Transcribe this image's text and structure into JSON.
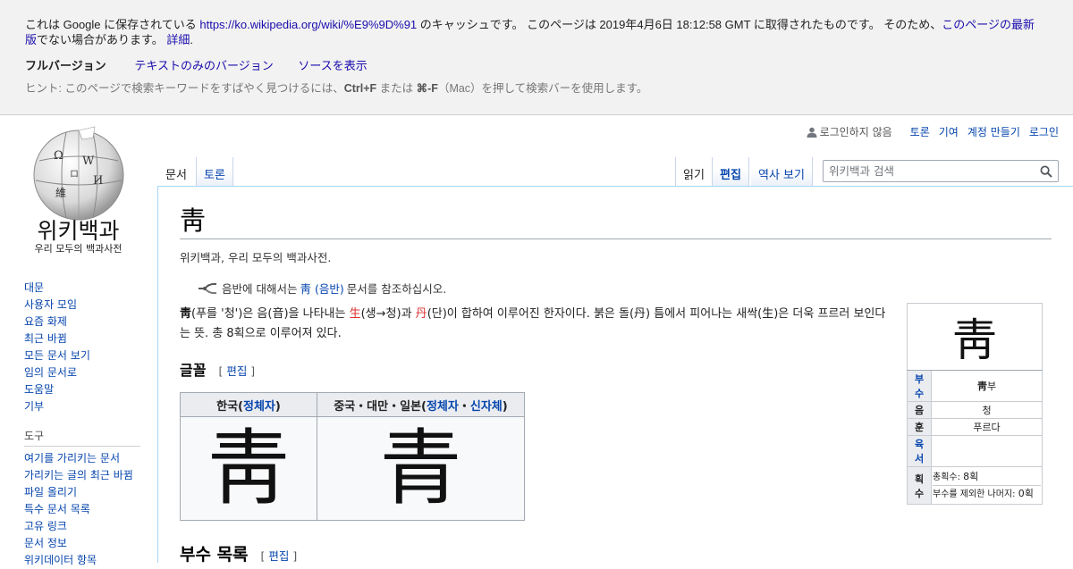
{
  "cache_banner": {
    "text_before_url": "これは Google に保存されている ",
    "url": "https://ko.wikipedia.org/wiki/%E9%9D%91",
    "text_after_url": " のキャッシュです。 このページは 2019年4月6日 18:12:58 GMT に取得されたものです。 そのため、",
    "latest_link": "このページの最新版",
    "text_end": "でない場合があります。",
    "details_link": "詳細",
    "period": ".",
    "full_version": "フルバージョン",
    "text_only_version": "テキストのみのバージョン",
    "view_source": "ソースを表示",
    "hint_before": "ヒント: このページで検索キーワードをすばやく見つけるには、",
    "hint_key1": "Ctrl+F",
    "hint_mid": " または ",
    "hint_key2": "⌘-F",
    "hint_after": "（Mac）を押して検索バーを使用します。"
  },
  "logo": {
    "wordmark": "위키백과",
    "tagline": "우리 모두의 백과사전"
  },
  "sidebar": {
    "nav": [
      "대문",
      "사용자 모임",
      "요즘 화제",
      "최근 바뀜",
      "모든 문서 보기",
      "임의 문서로",
      "도움말",
      "기부"
    ],
    "tools_title": "도구",
    "tools": [
      "여기를 가리키는 문서",
      "가리키는 글의 최근 바뀜",
      "파일 올리기",
      "특수 문서 목록",
      "고유 링크",
      "문서 정보",
      "위키데이터 항목"
    ]
  },
  "personal": {
    "not_logged_in": "로그인하지 않음",
    "talk": "토론",
    "contributions": "기여",
    "create_account": "계정 만들기",
    "login": "로그인"
  },
  "tabs": {
    "article": "문서",
    "talk": "토론",
    "read": "읽기",
    "edit": "편집",
    "history": "역사 보기"
  },
  "search": {
    "placeholder": "위키백과 검색"
  },
  "article": {
    "title": "靑",
    "site_sub": "위키백과, 우리 모두의 백과사전.",
    "hatnote_before": "음반에 대해서는 ",
    "hatnote_link": "靑 (음반)",
    "hatnote_after": " 문서를 참조하십시오.",
    "lead_bold": "靑",
    "lead_1": "(푸를 '청')은 음(音)을 나타내는 ",
    "lead_red1": "生",
    "lead_2": "(생→청)과 ",
    "lead_red2": "丹",
    "lead_3": "(단)이 합하여 이루어진 한자이다. 붉은 돌(丹) 틈에서 피어나는 새싹(生)은 더욱 프르러 보인다는 뜻. 총 8획으로 이루어져 있다.",
    "section_glyph": "글꼴",
    "edit_label": "편집",
    "section_radicals": "부수 목록"
  },
  "glyph_table": {
    "header1_before": "한국(",
    "header1_link": "정체자",
    "header1_after": ")",
    "header2_before": "중국・대만・일본(",
    "header2_link1": "정체자",
    "header2_sep": "・",
    "header2_link2": "신자체",
    "header2_after": ")",
    "glyph_korea": "靑",
    "glyph_cjk": "青"
  },
  "infobox": {
    "glyph": "靑",
    "radical_label": "부수",
    "radical_char": "靑",
    "radical_suffix": "부",
    "reading_label": "음",
    "reading_value": "청",
    "meaning_label": "훈",
    "meaning_value": "푸르다",
    "yuseo_label": "육서",
    "yuseo_value": "",
    "strokes_label": "획수",
    "total_strokes_label": "총획수",
    "total_strokes_value": "8획",
    "remaining_label": "부수를 제외한 나머지",
    "remaining_value": "0획"
  },
  "colors": {
    "link": "#0645ad",
    "red_char": "#dd3333",
    "banner_bg": "#f2f2f2",
    "content_border": "#a7d7f9"
  }
}
